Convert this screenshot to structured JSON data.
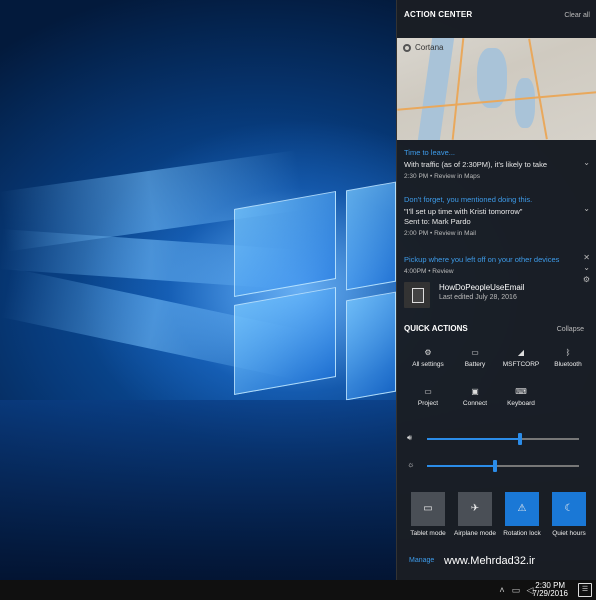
{
  "action_center": {
    "title": "ACTION CENTER",
    "clear_all": "Clear all",
    "cortana": {
      "label": "Cortana"
    },
    "notifications": [
      {
        "header": "Time to leave...",
        "body": "With traffic (as of 2:30PM), it's likely to take",
        "meta": "2:30 PM  •  Review in Maps"
      },
      {
        "header": "Don't forget, you mentioned doing this.",
        "body": "\"I'll set up time with Kristi tomorrow\"",
        "body2": "Sent to: Mark Pardo",
        "meta": "2:00 PM  •  Review in Mail"
      },
      {
        "header": "Pickup where you left off on your other devices",
        "meta": "4:00PM  •  Review",
        "doc_title": "HowDoPeopleUseEmail",
        "doc_sub": "Last edited July 28, 2016"
      }
    ],
    "quick_actions": {
      "title": "QUICK ACTIONS",
      "collapse": "Collapse",
      "row1": [
        "All settings",
        "Battery",
        "MSFTCORP",
        "Bluetooth"
      ],
      "row2": [
        "Project",
        "Connect",
        "Keyboard"
      ],
      "tiles": [
        "Tablet mode",
        "Airplane mode",
        "Rotation lock",
        "Quiet hours"
      ],
      "volume_level": 0.61,
      "brightness_level": 0.45
    },
    "manage": "Manage",
    "watermark": "www.Mehrdad32.ir"
  },
  "taskbar": {
    "time": "2:30 PM",
    "date": "7/29/2016"
  },
  "colors": {
    "accent": "#1a78d6",
    "link": "#3d9be9",
    "panel": "#1a1e24"
  }
}
